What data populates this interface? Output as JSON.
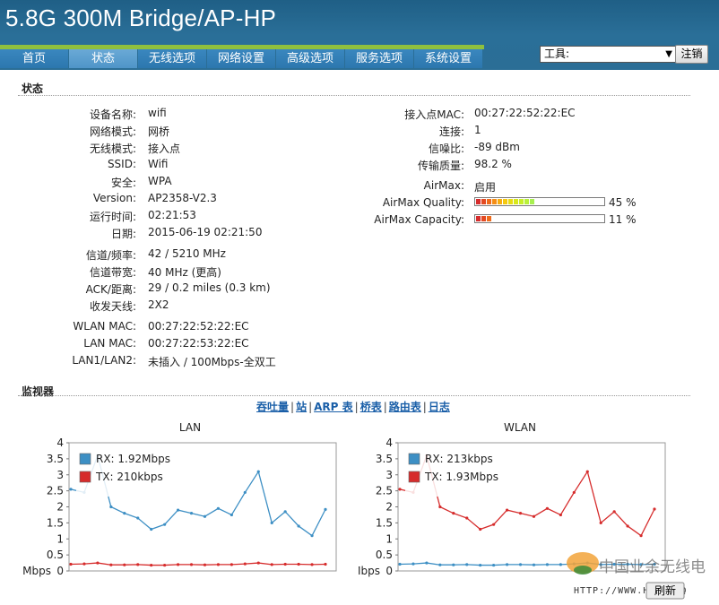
{
  "app": {
    "title": "5.8G 300M Bridge/AP-HP"
  },
  "tabs": [
    "首页",
    "状态",
    "无线选项",
    "网络设置",
    "高级选项",
    "服务选项",
    "系统设置"
  ],
  "active_tab": 1,
  "tools": {
    "selected": "工具:",
    "logout_label": "注销"
  },
  "status": {
    "title": "状态",
    "left": [
      {
        "label": "设备名称:",
        "value": "wifi"
      },
      {
        "label": "网络模式:",
        "value": "网桥"
      },
      {
        "label": "无线模式:",
        "value": "接入点"
      },
      {
        "label": "SSID:",
        "value": "Wifi"
      },
      {
        "label": "安全:",
        "value": "WPA"
      },
      {
        "label": "Version:",
        "value": "AP2358-V2.3"
      },
      {
        "label": "运行时间:",
        "value": "02:21:53"
      },
      {
        "label": "日期:",
        "value": "2015-06-19 02:21:50"
      },
      {
        "label": "信道/频率:",
        "value": "42 / 5210 MHz"
      },
      {
        "label": "信道带宽:",
        "value": "40 MHz (更高)"
      },
      {
        "label": "ACK/距离:",
        "value": "29 / 0.2 miles (0.3 km)"
      },
      {
        "label": "收发天线:",
        "value": "2X2"
      },
      {
        "label": "WLAN MAC:",
        "value": "00:27:22:52:22:EC"
      },
      {
        "label": "LAN MAC:",
        "value": "00:27:22:53:22:EC"
      },
      {
        "label": "LAN1/LAN2:",
        "value": "未插入 / 100Mbps-全双工"
      }
    ],
    "right": [
      {
        "label": "接入点MAC:",
        "value": "00:27:22:52:22:EC"
      },
      {
        "label": "连接:",
        "value": "1"
      },
      {
        "label": "信噪比:",
        "value": "-89 dBm"
      },
      {
        "label": "传输质量:",
        "value": "98.2 %"
      },
      {
        "label": "AirMax:",
        "value": "启用"
      }
    ],
    "airmax_quality": {
      "label": "AirMax Quality:",
      "percent": 45,
      "text": "45 %"
    },
    "airmax_capacity": {
      "label": "AirMax Capacity:",
      "percent": 11,
      "text": "11 %"
    }
  },
  "monitor": {
    "title": "监视器",
    "links": [
      "吞吐量",
      "站",
      "ARP 表",
      "桥表",
      "路由表",
      "日志"
    ],
    "separator": "|"
  },
  "colors": {
    "rx": "#3d8fc4",
    "tx": "#d62c2c",
    "header": "#2a6f98",
    "green": "#8fc03e"
  },
  "chart_data": [
    {
      "type": "line",
      "title": "LAN",
      "ylabel": "Mbps",
      "ylim": [
        0,
        4
      ],
      "yticks": [
        "0",
        "0.5",
        "1",
        "1.5",
        "2",
        "2.5",
        "3",
        "3.5",
        "4"
      ],
      "series": [
        {
          "name": "RX: 1.92Mbps",
          "color": "#3d8fc4",
          "values": [
            2.55,
            2.45,
            3.6,
            2.0,
            1.8,
            1.65,
            1.3,
            1.45,
            1.9,
            1.8,
            1.7,
            1.95,
            1.75,
            2.45,
            3.1,
            1.5,
            1.85,
            1.4,
            1.1,
            1.92
          ]
        },
        {
          "name": "TX: 210kbps",
          "color": "#d62c2c",
          "values": [
            0.21,
            0.22,
            0.25,
            0.19,
            0.19,
            0.2,
            0.18,
            0.18,
            0.2,
            0.2,
            0.19,
            0.2,
            0.2,
            0.22,
            0.25,
            0.2,
            0.21,
            0.21,
            0.2,
            0.21
          ]
        }
      ]
    },
    {
      "type": "line",
      "title": "WLAN",
      "ylabel": "Mbps",
      "ylim": [
        0,
        4
      ],
      "yticks": [
        "0",
        "0.5",
        "1",
        "1.5",
        "2",
        "2.5",
        "3",
        "3.5",
        "4"
      ],
      "series": [
        {
          "name": "RX: 213kbps",
          "color": "#3d8fc4",
          "values": [
            0.21,
            0.22,
            0.25,
            0.19,
            0.19,
            0.2,
            0.18,
            0.18,
            0.2,
            0.2,
            0.19,
            0.2,
            0.2,
            0.22,
            0.25,
            0.2,
            0.21,
            0.21,
            0.2,
            0.21
          ]
        },
        {
          "name": "TX: 1.93Mbps",
          "color": "#d62c2c",
          "values": [
            2.55,
            2.45,
            3.6,
            2.0,
            1.8,
            1.65,
            1.3,
            1.45,
            1.9,
            1.8,
            1.7,
            1.95,
            1.75,
            2.45,
            3.1,
            1.5,
            1.85,
            1.4,
            1.1,
            1.93
          ]
        }
      ]
    }
  ],
  "watermark": {
    "text": "中国业余无线电",
    "url": "HTTP://WWW.HELLOCQ",
    "button": "刷新"
  }
}
